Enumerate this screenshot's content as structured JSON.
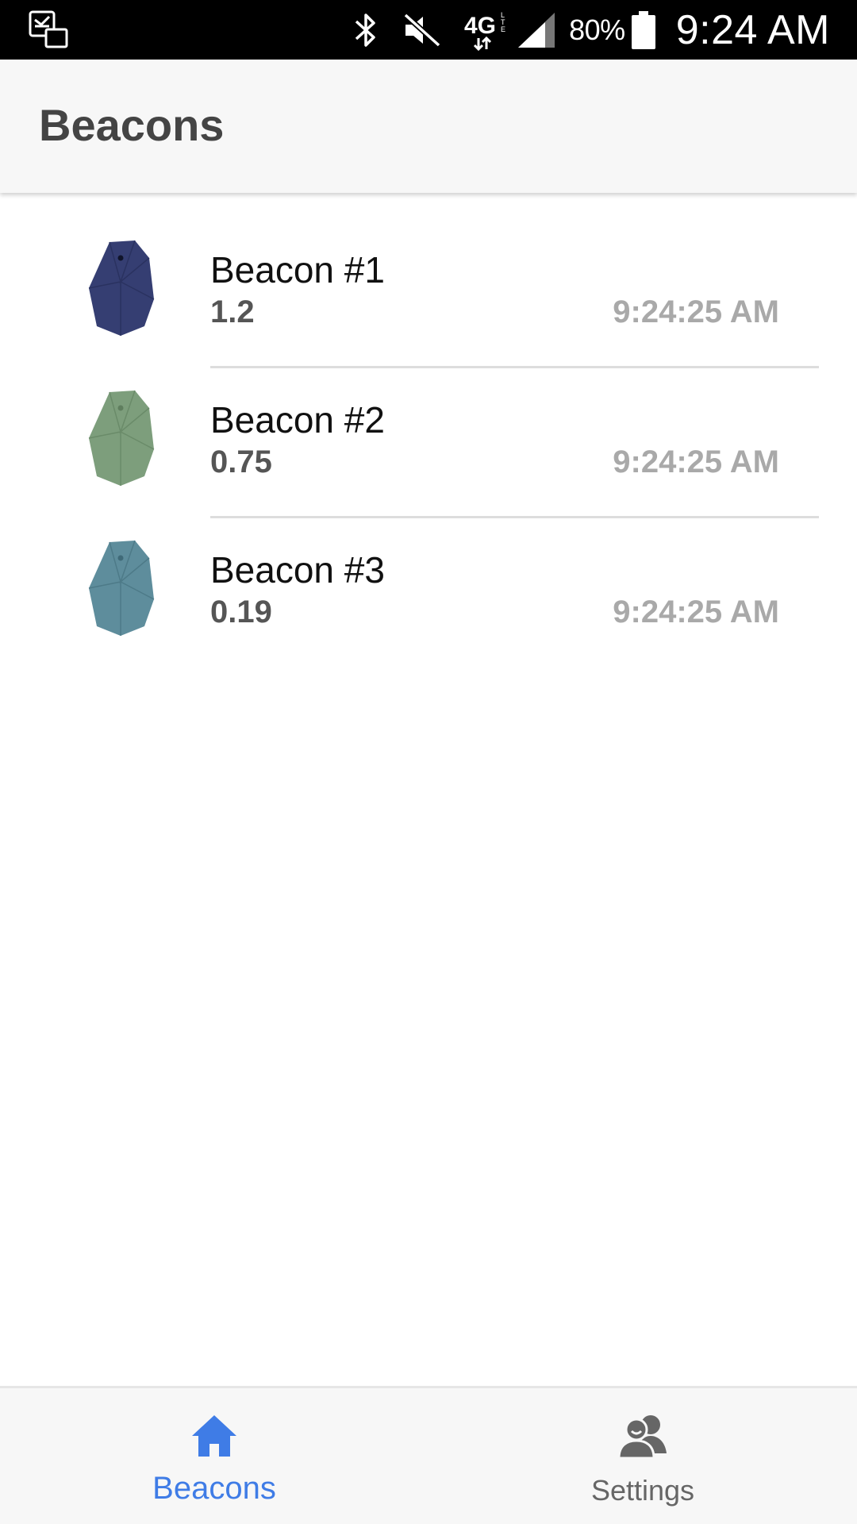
{
  "status_bar": {
    "battery_percent": "80%",
    "time": "9:24 AM",
    "icons": [
      "screenshot-icon",
      "bluetooth-icon",
      "mute-icon",
      "4g-lte-icon",
      "signal-icon",
      "battery-icon"
    ]
  },
  "header": {
    "title": "Beacons"
  },
  "beacons": [
    {
      "name": "Beacon #1",
      "distance": "1.2",
      "time": "9:24:25 AM",
      "color": "#353e72"
    },
    {
      "name": "Beacon #2",
      "distance": "0.75",
      "time": "9:24:25 AM",
      "color": "#7d9e7c"
    },
    {
      "name": "Beacon #3",
      "distance": "0.19",
      "time": "9:24:25 AM",
      "color": "#5e8d9c"
    }
  ],
  "tabs": [
    {
      "label": "Beacons",
      "icon": "home-icon",
      "active": true,
      "color": "#3f7ce6"
    },
    {
      "label": "Settings",
      "icon": "users-icon",
      "active": false,
      "color": "#666666"
    }
  ]
}
